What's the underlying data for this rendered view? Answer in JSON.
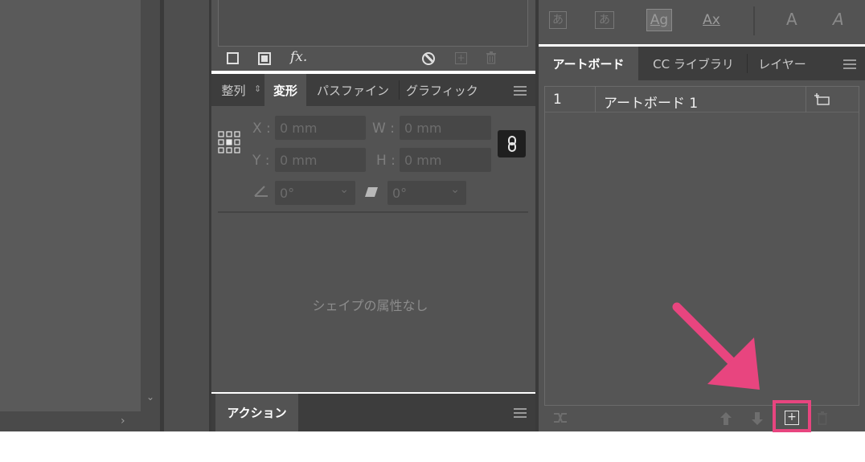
{
  "top_toolbar": {
    "icons": [
      "hiragana-a-icon",
      "strikethrough-text-icon",
      "ag-text-icon",
      "ax-text-icon",
      "char-a-icon",
      "char-a-accent-icon"
    ],
    "ag_label": "Ag",
    "ax_label": "Ax"
  },
  "appearance_toolbar": {
    "fx_label": "fx."
  },
  "transform_panel": {
    "tabs": [
      "整列",
      "変形",
      "パスファイン",
      "グラフィック"
    ],
    "active_tab": "変形",
    "x_label": "X :",
    "y_label": "Y :",
    "w_label": "W :",
    "h_label": "H :",
    "x_value": "0 mm",
    "y_value": "0 mm",
    "w_value": "0 mm",
    "h_value": "0 mm",
    "rotate_value": "0°",
    "shear_value": "0°",
    "no_shape_text": "シェイプの属性なし"
  },
  "actions_panel": {
    "tab": "アクション"
  },
  "artboards_panel": {
    "tabs": [
      "アートボード",
      "CC ライブラリ",
      "レイヤー"
    ],
    "active_tab": "アートボード",
    "rows": [
      {
        "index": "1",
        "name": "アートボード 1"
      }
    ]
  },
  "colors": {
    "panel_bg": "#535353",
    "tabbar_bg": "#3d3d3d",
    "highlight_pink": "#e8457f"
  }
}
